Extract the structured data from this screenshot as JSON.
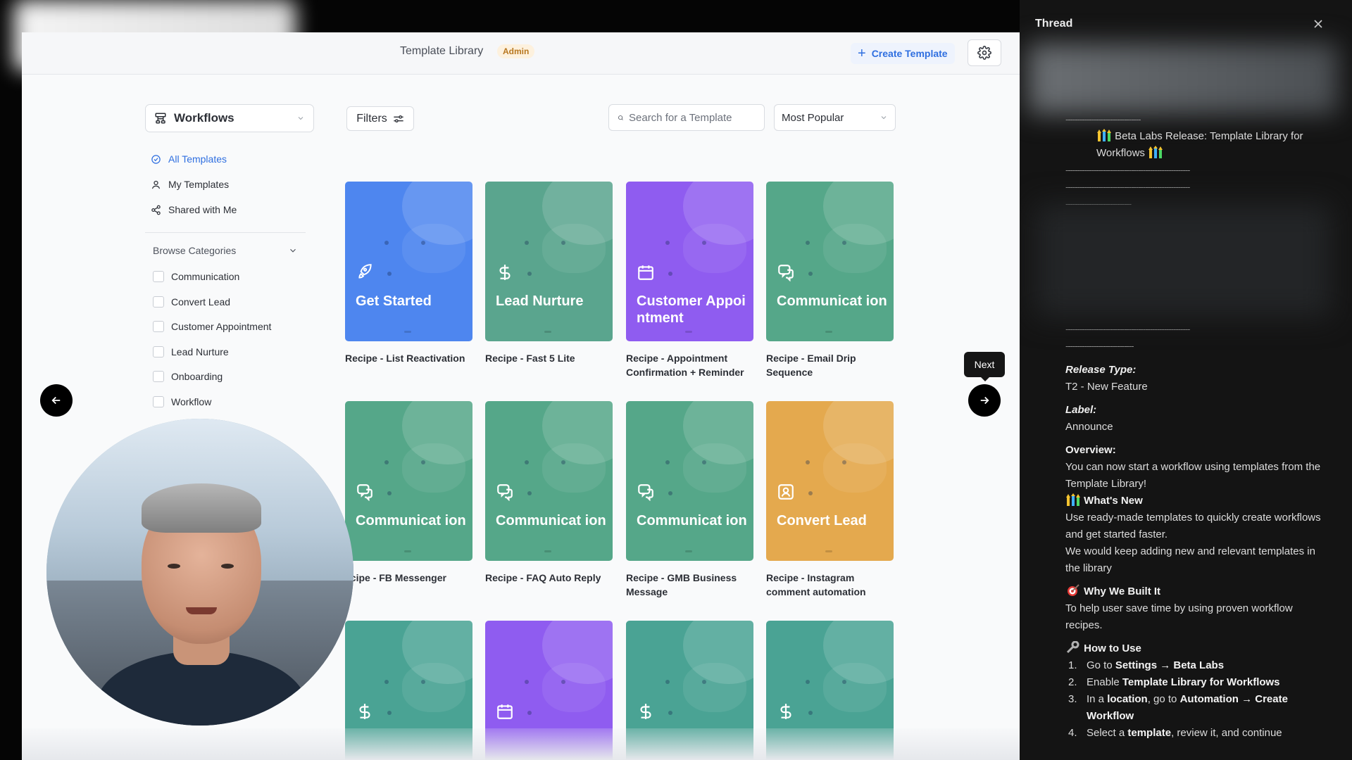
{
  "header": {
    "title": "Template Library",
    "badge": "Admin",
    "create_label": "Create Template"
  },
  "sidebar": {
    "select_label": "Workflows",
    "nav": [
      {
        "label": "All Templates"
      },
      {
        "label": "My Templates"
      },
      {
        "label": "Shared with Me"
      }
    ],
    "browse_label": "Browse Categories",
    "categories": [
      {
        "label": "Communication"
      },
      {
        "label": "Convert Lead"
      },
      {
        "label": "Customer Appointment"
      },
      {
        "label": "Lead Nurture"
      },
      {
        "label": "Onboarding"
      },
      {
        "label": "Workflow"
      }
    ]
  },
  "toolbar": {
    "filters_label": "Filters",
    "search_placeholder": "Search for a Template",
    "sort_value": "Most Popular"
  },
  "cards": [
    {
      "title": "Get Started",
      "label": "Recipe - List Reactivation",
      "icon": "rocket-icon",
      "color": "#4e86ef"
    },
    {
      "title": "Lead Nurture",
      "label": "Recipe - Fast 5 Lite",
      "icon": "dollar-icon",
      "color": "#5aa58e"
    },
    {
      "title": "Customer Appointment",
      "label": "Recipe - Appointment Confirmation + Reminder",
      "icon": "calendar-icon",
      "color": "#8f5cf0"
    },
    {
      "title": "Communicat ion",
      "label": "Recipe - Email Drip Sequence",
      "icon": "chat-icon",
      "color": "#55a789"
    },
    {
      "title": "Communicat ion",
      "label": "ecipe - FB Messenger",
      "icon": "chat-icon",
      "color": "#55a789"
    },
    {
      "title": "Communicat ion",
      "label": "Recipe - FAQ Auto Reply",
      "icon": "chat-icon",
      "color": "#55a789"
    },
    {
      "title": "Communicat ion",
      "label": "Recipe - GMB Business Message",
      "icon": "chat-icon",
      "color": "#55a789"
    },
    {
      "title": "Convert Lead",
      "label": "Recipe - Instagram comment automation",
      "icon": "user-badge-icon",
      "color": "#e4a94e"
    },
    {
      "title": "",
      "label": "",
      "icon": "dollar-icon",
      "color": "#4aa394"
    },
    {
      "title": "",
      "label": "",
      "icon": "calendar-icon",
      "color": "#8f5cf0"
    },
    {
      "title": "",
      "label": "",
      "icon": "dollar-icon",
      "color": "#4aa394"
    },
    {
      "title": "",
      "label": "",
      "icon": "dollar-icon",
      "color": "#4aa394"
    }
  ],
  "tooltip": {
    "next": "Next"
  },
  "thread": {
    "title": "Thread",
    "dashes1": "--------------------------------",
    "release_title": "Beta Labs Release: Template Library for Workflows",
    "dashes2": "-----------------------------------------------------",
    "dashes3": "-----------------------------------------------------",
    "dashes4": "----------------------------",
    "dashes5": "-----------------------------------------------------",
    "dashes6": "-----------------------------",
    "release_type_label": "Release Type:",
    "release_type_value": "T2 - New Feature",
    "label_label": "Label:",
    "label_value": "Announce",
    "overview_label": "Overview:",
    "overview_text": "You can now start a workflow using templates from the Template Library!",
    "whats_new_label": "What's New",
    "whats_new_text1": "Use ready-made templates to quickly create workflows and get started faster.",
    "whats_new_text2": "We would keep adding new and relevant templates in the library",
    "why_label": "Why We Built It",
    "why_text": "To help user save time by using proven workflow recipes.",
    "how_label": "How to Use",
    "step1_a": "Go to ",
    "step1_b": "Settings → Beta Labs",
    "step2_a": "Enable ",
    "step2_b": "Template Library for Workflows",
    "step3_a": "In a ",
    "step3_b": "location",
    "step3_c": ", go to ",
    "step3_d": "Automation → Create Workflow",
    "step4_a": "Select a ",
    "step4_b": "template",
    "step4_c": ", review it, and continue"
  }
}
